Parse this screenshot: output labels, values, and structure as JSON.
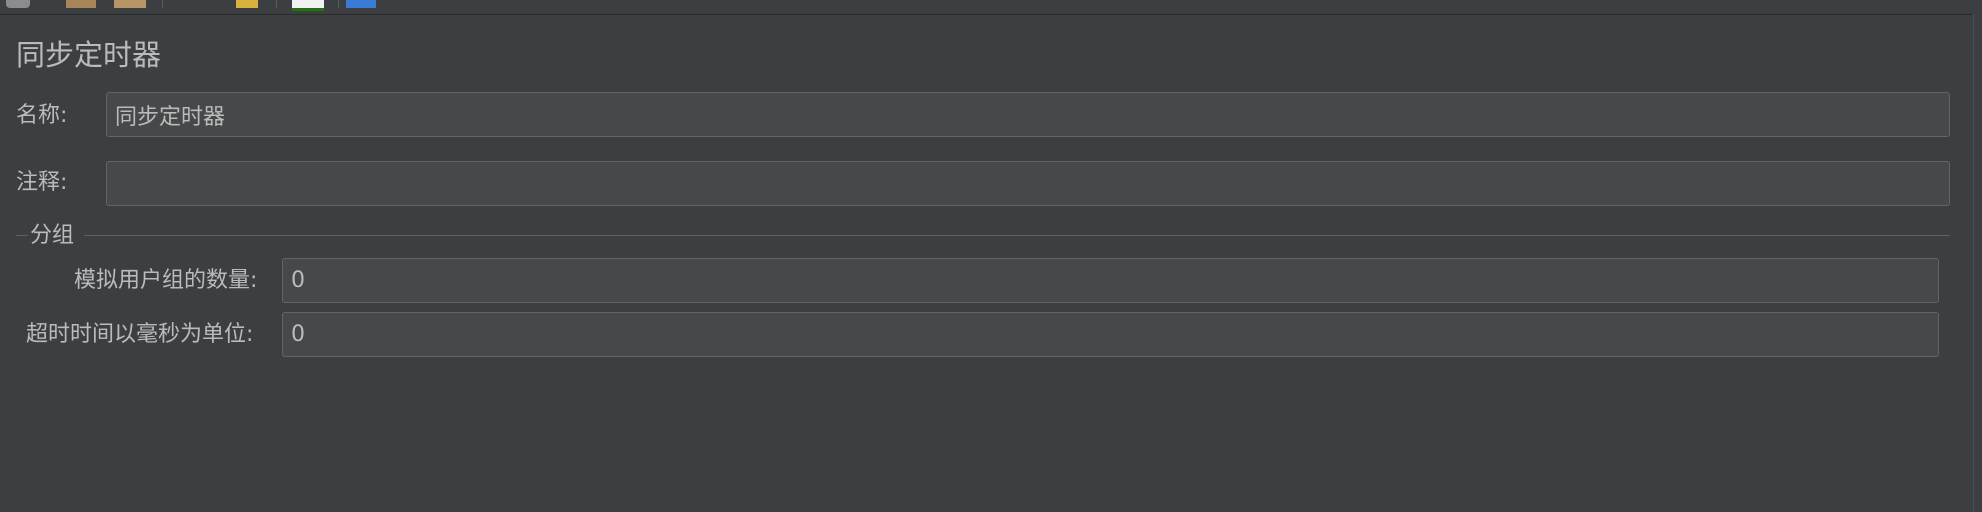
{
  "toolbar": {
    "icons": [
      "clipboard-icon",
      "paste-icon",
      "edit-icon",
      "chart-icon",
      "window-icon"
    ]
  },
  "header": {
    "title": "同步定时器"
  },
  "form": {
    "name_label": "名称:",
    "name_value": "同步定时器",
    "comment_label": "注释:",
    "comment_value": ""
  },
  "grouping": {
    "legend": "分组",
    "users_label": "模拟用户组的数量:",
    "users_value": "0",
    "timeout_label": "超时时间以毫秒为单位:",
    "timeout_value": "0"
  },
  "colors": {
    "background": "#3c3f41",
    "field_background": "#45494a",
    "field_border": "#646464",
    "text": "#bbbbbb"
  }
}
